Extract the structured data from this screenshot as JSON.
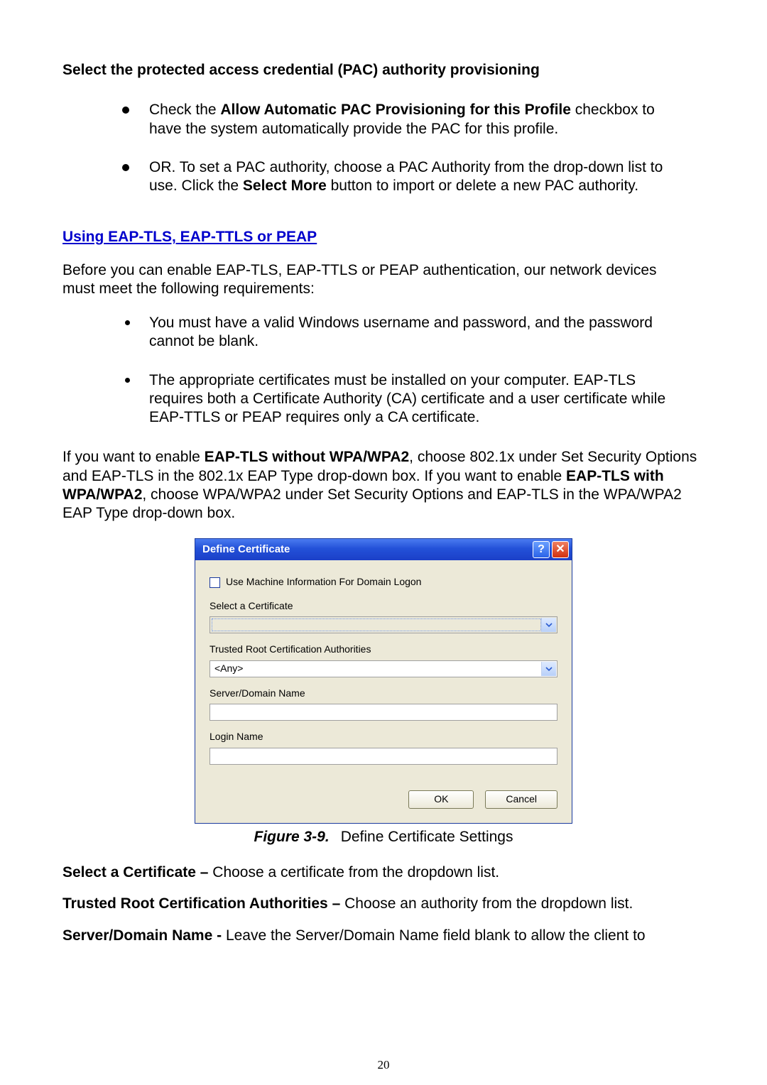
{
  "heading_pac": "Select the protected access credential (PAC) authority provisioning",
  "pac_bullets": [
    {
      "pre": "Check the ",
      "bold": "Allow Automatic PAC Provisioning for this Profile",
      "post": " checkbox to have the system automatically provide the PAC for this profile."
    },
    {
      "pre": "OR. To set a PAC authority, choose a PAC Authority from the drop-down list to use. Click the ",
      "bold": "Select More",
      "post": " button to import or delete a new PAC authority."
    }
  ],
  "subheading": "Using EAP-TLS, EAP-TTLS or PEAP",
  "intro": "Before you can enable EAP-TLS, EAP-TTLS or PEAP authentication, our network devices must meet the following requirements:",
  "req_bullets": [
    "You must have a valid Windows username and password, and the password cannot be blank.",
    "The appropriate certificates must be installed on your computer. EAP-TLS requires both a Certificate Authority (CA) certificate and a user certificate while EAP-TTLS or PEAP requires only a CA certificate."
  ],
  "enable_para": {
    "p1": "If you want to enable ",
    "b1": "EAP-TLS without WPA/WPA2",
    "p2": ", choose 802.1x under Set Security Options and EAP-TLS in the 802.1x EAP Type drop-down box. If you want to enable ",
    "b2": "EAP-TLS with WPA/WPA2",
    "p3": ", choose WPA/WPA2 under Set Security Options and EAP-TLS in the WPA/WPA2 EAP Type drop-down box."
  },
  "dialog": {
    "title": "Define Certificate",
    "use_machine": "Use Machine Information For Domain Logon",
    "select_cert": "Select a Certificate",
    "cert_value": "",
    "trusted_root": "Trusted Root Certification Authorities",
    "trusted_value": "<Any>",
    "server_domain": "Server/Domain Name",
    "login_name": "Login Name",
    "ok": "OK",
    "cancel": "Cancel"
  },
  "caption": {
    "label": "Figure 3-9.",
    "text": "Define Certificate Settings"
  },
  "defs": [
    {
      "term": "Select a Certificate – ",
      "text": "Choose a certificate from the dropdown list."
    },
    {
      "term": "Trusted Root Certification Authorities – ",
      "text": "Choose an authority from the dropdown list."
    },
    {
      "term": "Server/Domain Name - ",
      "text": "Leave the Server/Domain Name field blank to allow the client to"
    }
  ],
  "page_number": "20"
}
